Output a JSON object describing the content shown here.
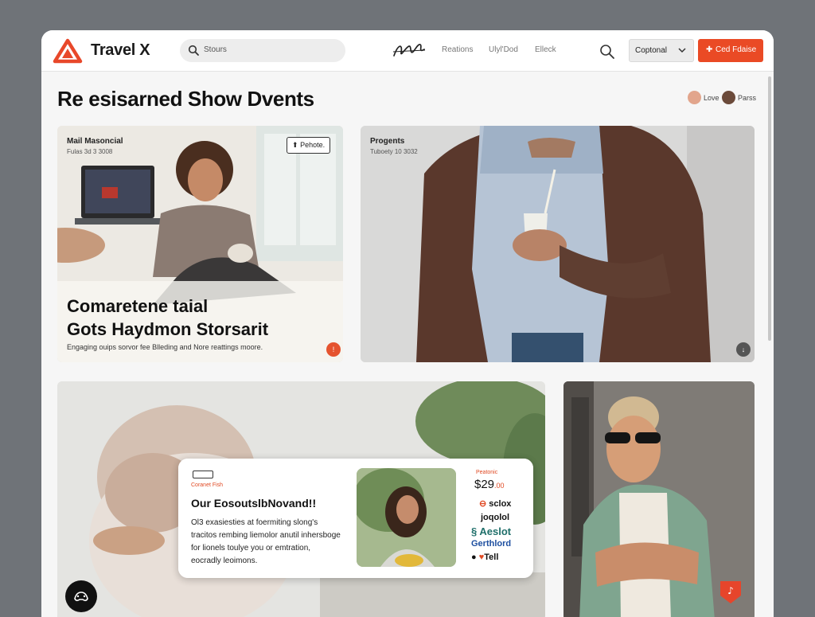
{
  "header": {
    "brand": "Travel X",
    "search_placeholder": "Stours",
    "nav": [
      "Reations",
      "Ulyl'Dod",
      "Elleck"
    ],
    "dropdown_value": "Coptonal",
    "cta_label": "Ced Fdaise",
    "accent": "#ea4a25"
  },
  "page": {
    "title": "Re esisarned Show Dvents",
    "avatars": [
      {
        "label": "Love",
        "color": "#e2a58c"
      },
      {
        "label": "Parss",
        "color": "#6b4a3a"
      }
    ]
  },
  "cards": {
    "card1": {
      "title": "Mail Masoncial",
      "sub": "Fulas 3d 3 3008",
      "tag": "Pehote.",
      "hero_lines": [
        "Comaretene taial",
        "Gots Haydmon Storsarit"
      ],
      "desc": "Engaging ouips sorvor fee Blleding and Nore reattings moore."
    },
    "card2": {
      "title": "Progents",
      "sub": "Tuboety 10 3032"
    },
    "overlay": {
      "kicker": "Coranet Fish",
      "title": "Our EosoutslbNovand!!",
      "body": "Ol3 exasiesties at foermiting slong's tracitos rembing liemolor anutil inhersboge for lionels toulye you or emtration, eocradly leoimons.",
      "price_label": "Peatonic",
      "price": "$29",
      "price_cents": ".00",
      "brands": [
        "sclox",
        "joqolol",
        "Aeslot",
        "Gerthlord",
        "Tell"
      ]
    }
  }
}
